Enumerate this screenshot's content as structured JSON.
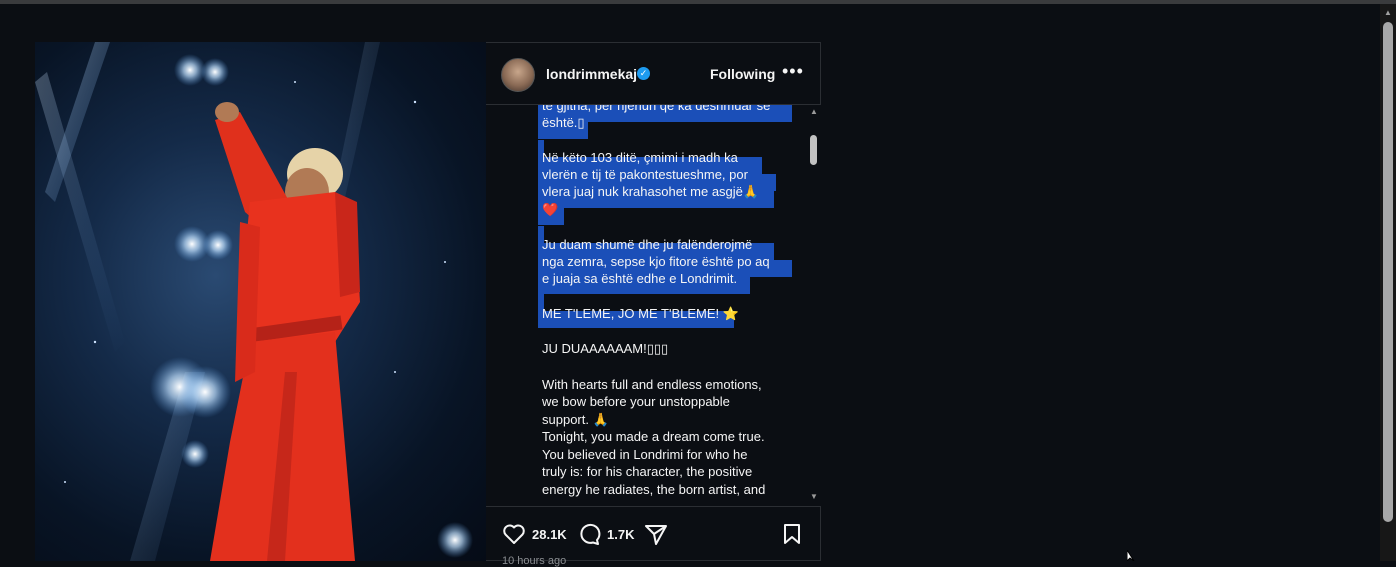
{
  "post": {
    "username": "londrimmekaj",
    "follow_label": "Following",
    "more_label": "•••",
    "verified_mark": "✓",
    "likes": "28.1K",
    "comments": "1.7K",
    "time": "10 hours ago"
  },
  "caption": {
    "lines": [
      "të gjitha, për njeriun që ka dëshmuar se",
      "është.▯",
      "",
      "Në këto 103 ditë, çmimi i madh ka",
      "vlerën e tij të pakontestueshme, por",
      "vlera juaj nuk krahasohet me asgjë🙏",
      "❤️",
      "",
      "Ju duam shumë dhe ju falënderojmë",
      "nga zemra, sepse kjo fitore është po aq",
      "e juaja sa është edhe e Londrimit.",
      "",
      "ME T'LEME, JO ME T'BLEME! ⭐",
      "",
      "JU DUAAAAAAM!▯▯▯",
      "",
      "With hearts full and endless emotions,",
      "we bow before your unstoppable",
      "support. 🙏",
      "Tonight, you made a dream come true.",
      "You believed in Londrimi for who he",
      "truly is: for his character, the positive",
      "energy he radiates, the born artist, and"
    ]
  },
  "colors": {
    "background": "#0b0e13",
    "highlight": "#1b4fb8",
    "verified": "#1d9bf0"
  }
}
